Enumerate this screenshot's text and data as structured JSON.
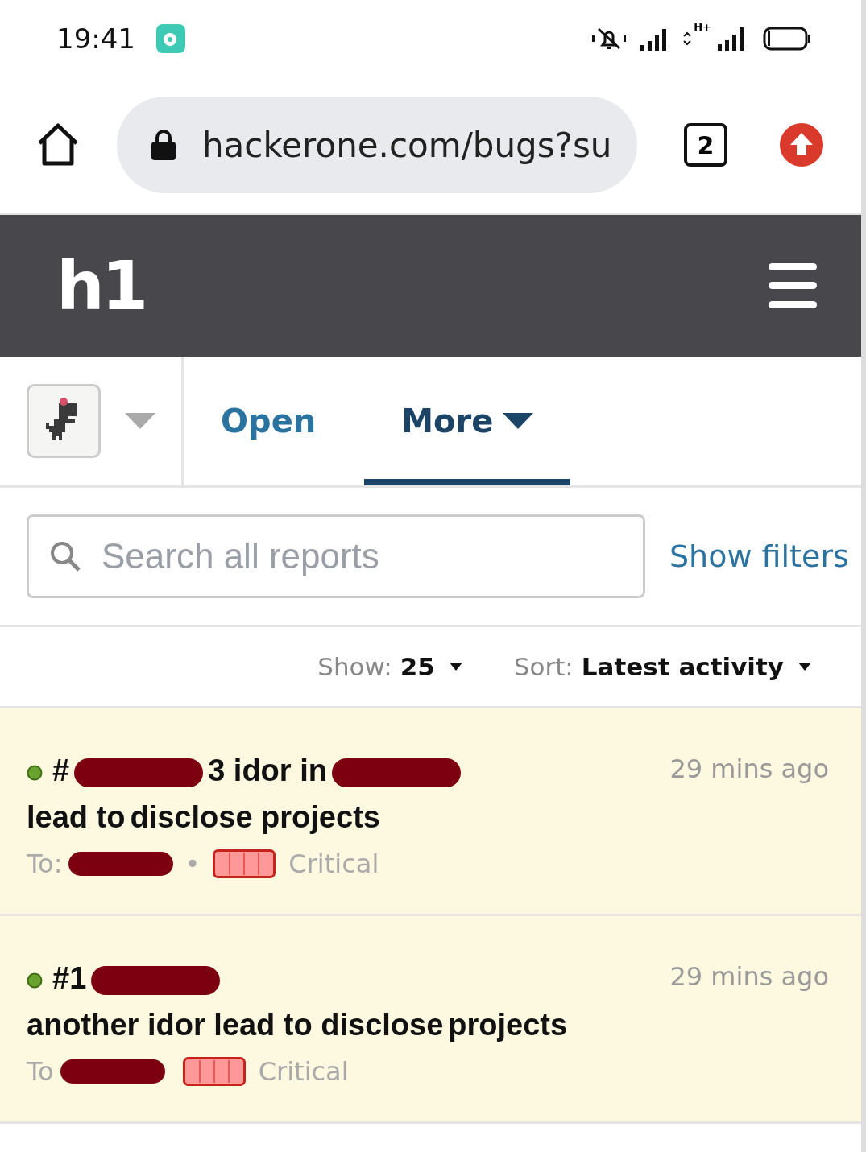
{
  "status_bar": {
    "time": "19:41"
  },
  "network_type": "H+",
  "browser": {
    "url": "hackerone.com/bugs?su",
    "tab_count": "2"
  },
  "header": {
    "logo": "h1"
  },
  "tabs": [
    {
      "label": "Open",
      "selected": false,
      "caret": false
    },
    {
      "label": "More",
      "selected": true,
      "caret": true
    }
  ],
  "search": {
    "placeholder": "Search all reports"
  },
  "show_filters": "Show filters",
  "list_controls": {
    "show_label": "Show:",
    "show_value": "25",
    "sort_label": "Sort:",
    "sort_value": "Latest activity"
  },
  "reports": [
    {
      "title": [
        {
          "kind": "text",
          "text": "#"
        },
        {
          "kind": "redacted"
        },
        {
          "kind": "text",
          "text": "3 idor in"
        },
        {
          "kind": "redacted"
        },
        {
          "kind": "text",
          "text": "lead to"
        },
        {
          "kind": "text",
          "text": "disclose projects"
        }
      ],
      "time": "29 mins ago",
      "meta": [
        {
          "kind": "text",
          "text": "To:"
        },
        {
          "kind": "redacted"
        },
        {
          "kind": "text",
          "text": "•"
        }
      ],
      "severity": "Critical"
    },
    {
      "title": [
        {
          "kind": "text",
          "text": "#1"
        },
        {
          "kind": "redacted"
        },
        {
          "kind": "text",
          "text": "another idor lead to disclose"
        },
        {
          "kind": "text",
          "text": "projects"
        }
      ],
      "time": "29 mins ago",
      "meta": [
        {
          "kind": "text",
          "text": "To"
        },
        {
          "kind": "redacted"
        }
      ],
      "severity": "Critical"
    }
  ]
}
